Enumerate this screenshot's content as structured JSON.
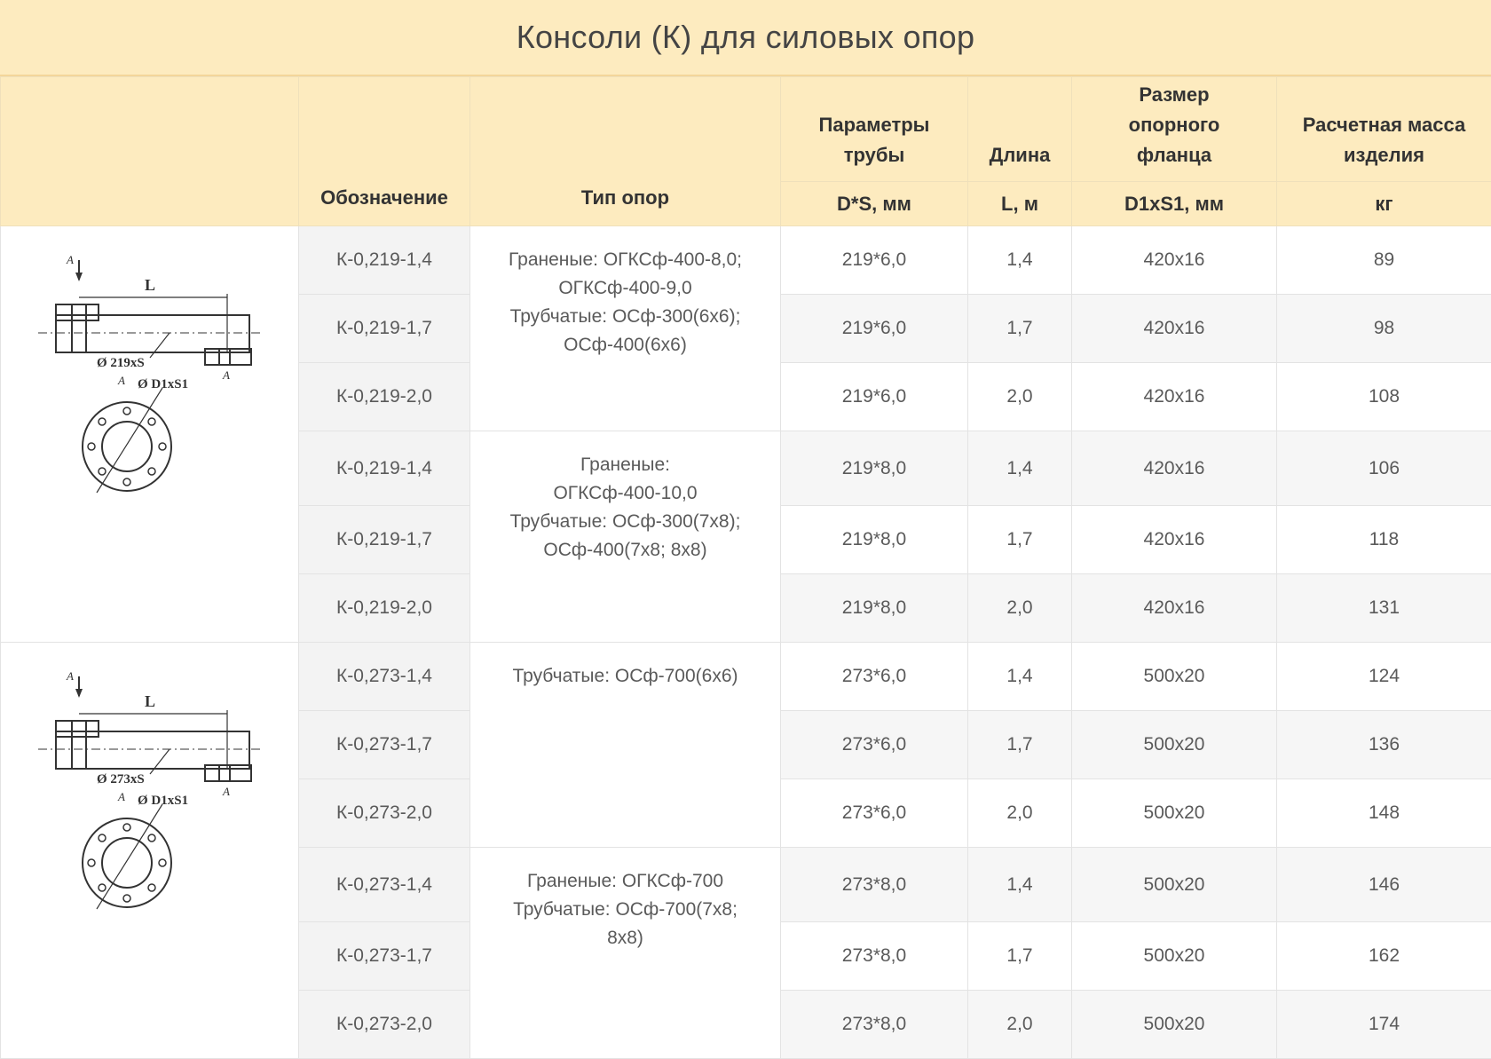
{
  "title": "Консоли (К) для силовых опор",
  "headers": {
    "designation": "Обозначение",
    "support_type": "Тип опор",
    "pipe_params_1": "Параметры",
    "pipe_params_2": "трубы",
    "length": "Длина",
    "flange_1": "Размер",
    "flange_2": "опорного",
    "flange_3": "фланца",
    "mass_1": "Расчетная масса",
    "mass_2": "изделия",
    "unit_pipe": "D*S, мм",
    "unit_length": "L, м",
    "unit_flange": "D1xS1, мм",
    "unit_mass": "кг"
  },
  "drawings": [
    {
      "length_label": "L",
      "pipe_label": "Ø 219xS",
      "flange_label": "Ø D1xS1",
      "section_label": "A"
    },
    {
      "length_label": "L",
      "pipe_label": "Ø 273xS",
      "flange_label": "Ø D1xS1",
      "section_label": "A"
    }
  ],
  "groups": [
    {
      "type_lines": [
        "Граненые: ОГКСф-400-8,0;",
        "ОГКСф-400-9,0",
        "Трубчатые: ОСф-300(6х6);",
        "ОСф-400(6х6)"
      ]
    },
    {
      "type_lines": [
        "Граненые:",
        "ОГКСф-400-10,0",
        "Трубчатые: ОСф-300(7х8);",
        "ОСф-400(7х8; 8х8)"
      ]
    },
    {
      "type_lines": [
        "Трубчатые: ОСф-700(6х6)"
      ]
    },
    {
      "type_lines": [
        "Граненые: ОГКСф-700",
        "Трубчатые: ОСф-700(7х8;",
        "8х8)"
      ]
    }
  ],
  "rows": [
    {
      "designation": "К-0,219-1,4",
      "pipe": "219*6,0",
      "length": "1,4",
      "flange": "420х16",
      "mass": "89"
    },
    {
      "designation": "К-0,219-1,7",
      "pipe": "219*6,0",
      "length": "1,7",
      "flange": "420х16",
      "mass": "98"
    },
    {
      "designation": "К-0,219-2,0",
      "pipe": "219*6,0",
      "length": "2,0",
      "flange": "420х16",
      "mass": "108"
    },
    {
      "designation": "К-0,219-1,4",
      "pipe": "219*8,0",
      "length": "1,4",
      "flange": "420х16",
      "mass": "106"
    },
    {
      "designation": "К-0,219-1,7",
      "pipe": "219*8,0",
      "length": "1,7",
      "flange": "420х16",
      "mass": "118"
    },
    {
      "designation": "К-0,219-2,0",
      "pipe": "219*8,0",
      "length": "2,0",
      "flange": "420х16",
      "mass": "131"
    },
    {
      "designation": "К-0,273-1,4",
      "pipe": "273*6,0",
      "length": "1,4",
      "flange": "500х20",
      "mass": "124"
    },
    {
      "designation": "К-0,273-1,7",
      "pipe": "273*6,0",
      "length": "1,7",
      "flange": "500х20",
      "mass": "136"
    },
    {
      "designation": "К-0,273-2,0",
      "pipe": "273*6,0",
      "length": "2,0",
      "flange": "500х20",
      "mass": "148"
    },
    {
      "designation": "К-0,273-1,4",
      "pipe": "273*8,0",
      "length": "1,4",
      "flange": "500х20",
      "mass": "146"
    },
    {
      "designation": "К-0,273-1,7",
      "pipe": "273*8,0",
      "length": "1,7",
      "flange": "500х20",
      "mass": "162"
    },
    {
      "designation": "К-0,273-2,0",
      "pipe": "273*8,0",
      "length": "2,0",
      "flange": "500х20",
      "mass": "174"
    }
  ]
}
